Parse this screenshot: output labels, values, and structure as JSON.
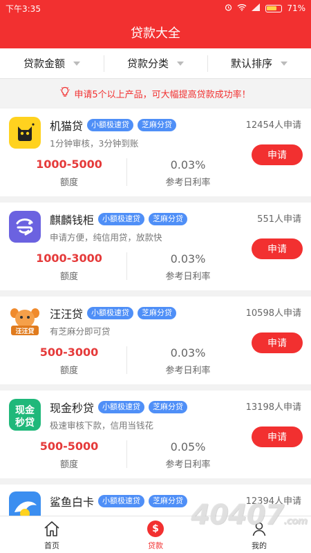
{
  "status_bar": {
    "time": "下午3:35",
    "battery": "71%"
  },
  "header": {
    "title": "贷款大全"
  },
  "filters": [
    {
      "label": "贷款金额"
    },
    {
      "label": "贷款分类"
    },
    {
      "label": "默认排序"
    }
  ],
  "notice": {
    "text": "申请5个以上产品，可大幅提高贷款成功率！"
  },
  "labels": {
    "amount": "额度",
    "rate": "参考日利率",
    "apply": "申请"
  },
  "products": [
    {
      "name": "机猫贷",
      "tags": [
        "小额极速贷",
        "芝麻分贷"
      ],
      "applicants": "12454人申请",
      "desc": "1分钟审核，3分钟到账",
      "amount": "1000-5000",
      "rate": "0.03%"
    },
    {
      "name": "麒麟钱柜",
      "tags": [
        "小额极速贷",
        "芝麻分贷"
      ],
      "applicants": "551人申请",
      "desc": "申请方便，纯信用贷，放款快",
      "amount": "1000-3000",
      "rate": "0.03%"
    },
    {
      "name": "汪汪贷",
      "tags": [
        "小额极速贷",
        "芝麻分贷"
      ],
      "applicants": "10598人申请",
      "desc": "有芝麻分即可贷",
      "amount": "500-3000",
      "rate": "0.03%"
    },
    {
      "name": "现金秒贷",
      "tags": [
        "小额极速贷",
        "芝麻分贷"
      ],
      "applicants": "13198人申请",
      "desc": "极速审核下款，信用当钱花",
      "amount": "500-5000",
      "rate": "0.05%"
    },
    {
      "name": "鲨鱼白卡",
      "tags": [
        "小额极速贷",
        "芝麻分贷"
      ],
      "applicants": "12394人申请"
    }
  ],
  "logos": {
    "xianjin_line1": "现金",
    "xianjin_line2": "秒贷",
    "wangwang": "汪汪贷"
  },
  "tabbar": [
    {
      "label": "首页",
      "icon": "home-icon"
    },
    {
      "label": "贷款",
      "icon": "dollar-icon",
      "glyph": "$"
    },
    {
      "label": "我的",
      "icon": "user-icon"
    }
  ],
  "watermark": {
    "text": "40407",
    "suffix": ".com"
  },
  "colors": {
    "brand": "#f23030",
    "tag": "#4f8ff7",
    "amount": "#e53a3a"
  }
}
